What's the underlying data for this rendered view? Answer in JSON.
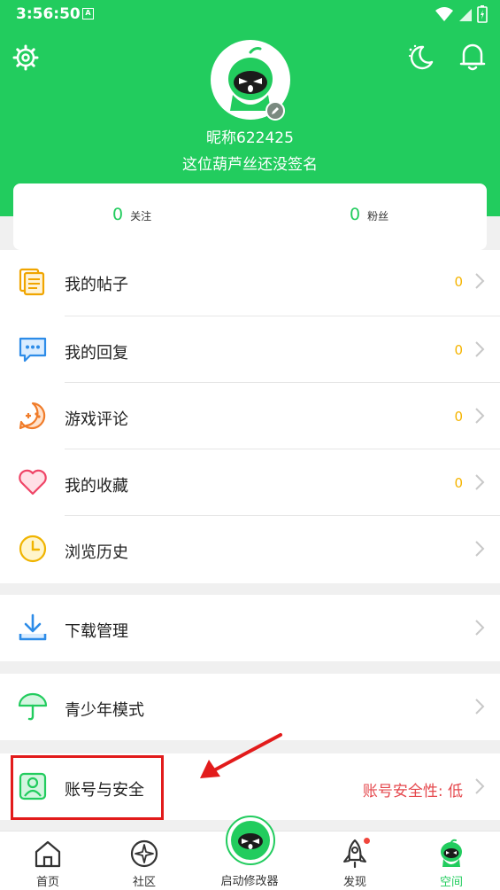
{
  "status_bar": {
    "time": "3:56:50",
    "notif_badge": "A"
  },
  "header": {
    "nickname": "昵称622425",
    "signature": "这位葫芦丝还没签名"
  },
  "stats": {
    "follow": {
      "count": "0",
      "label": "关注"
    },
    "fans": {
      "count": "0",
      "label": "粉丝"
    }
  },
  "menu": {
    "posts": {
      "label": "我的帖子",
      "count": "0"
    },
    "replies": {
      "label": "我的回复",
      "count": "0"
    },
    "reviews": {
      "label": "游戏评论",
      "count": "0"
    },
    "favorites": {
      "label": "我的收藏",
      "count": "0"
    },
    "history": {
      "label": "浏览历史"
    },
    "downloads": {
      "label": "下载管理"
    },
    "youth": {
      "label": "青少年模式"
    },
    "account": {
      "label": "账号与安全",
      "status": "账号安全性: 低"
    }
  },
  "nav": {
    "home": "首页",
    "community": "社区",
    "launcher": "启动修改器",
    "discover": "发现",
    "space": "空间"
  },
  "colors": {
    "brand": "#22cc5e",
    "accent_count": "#f5b400",
    "warning": "#e5484d",
    "highlight": "#e21b1b"
  }
}
